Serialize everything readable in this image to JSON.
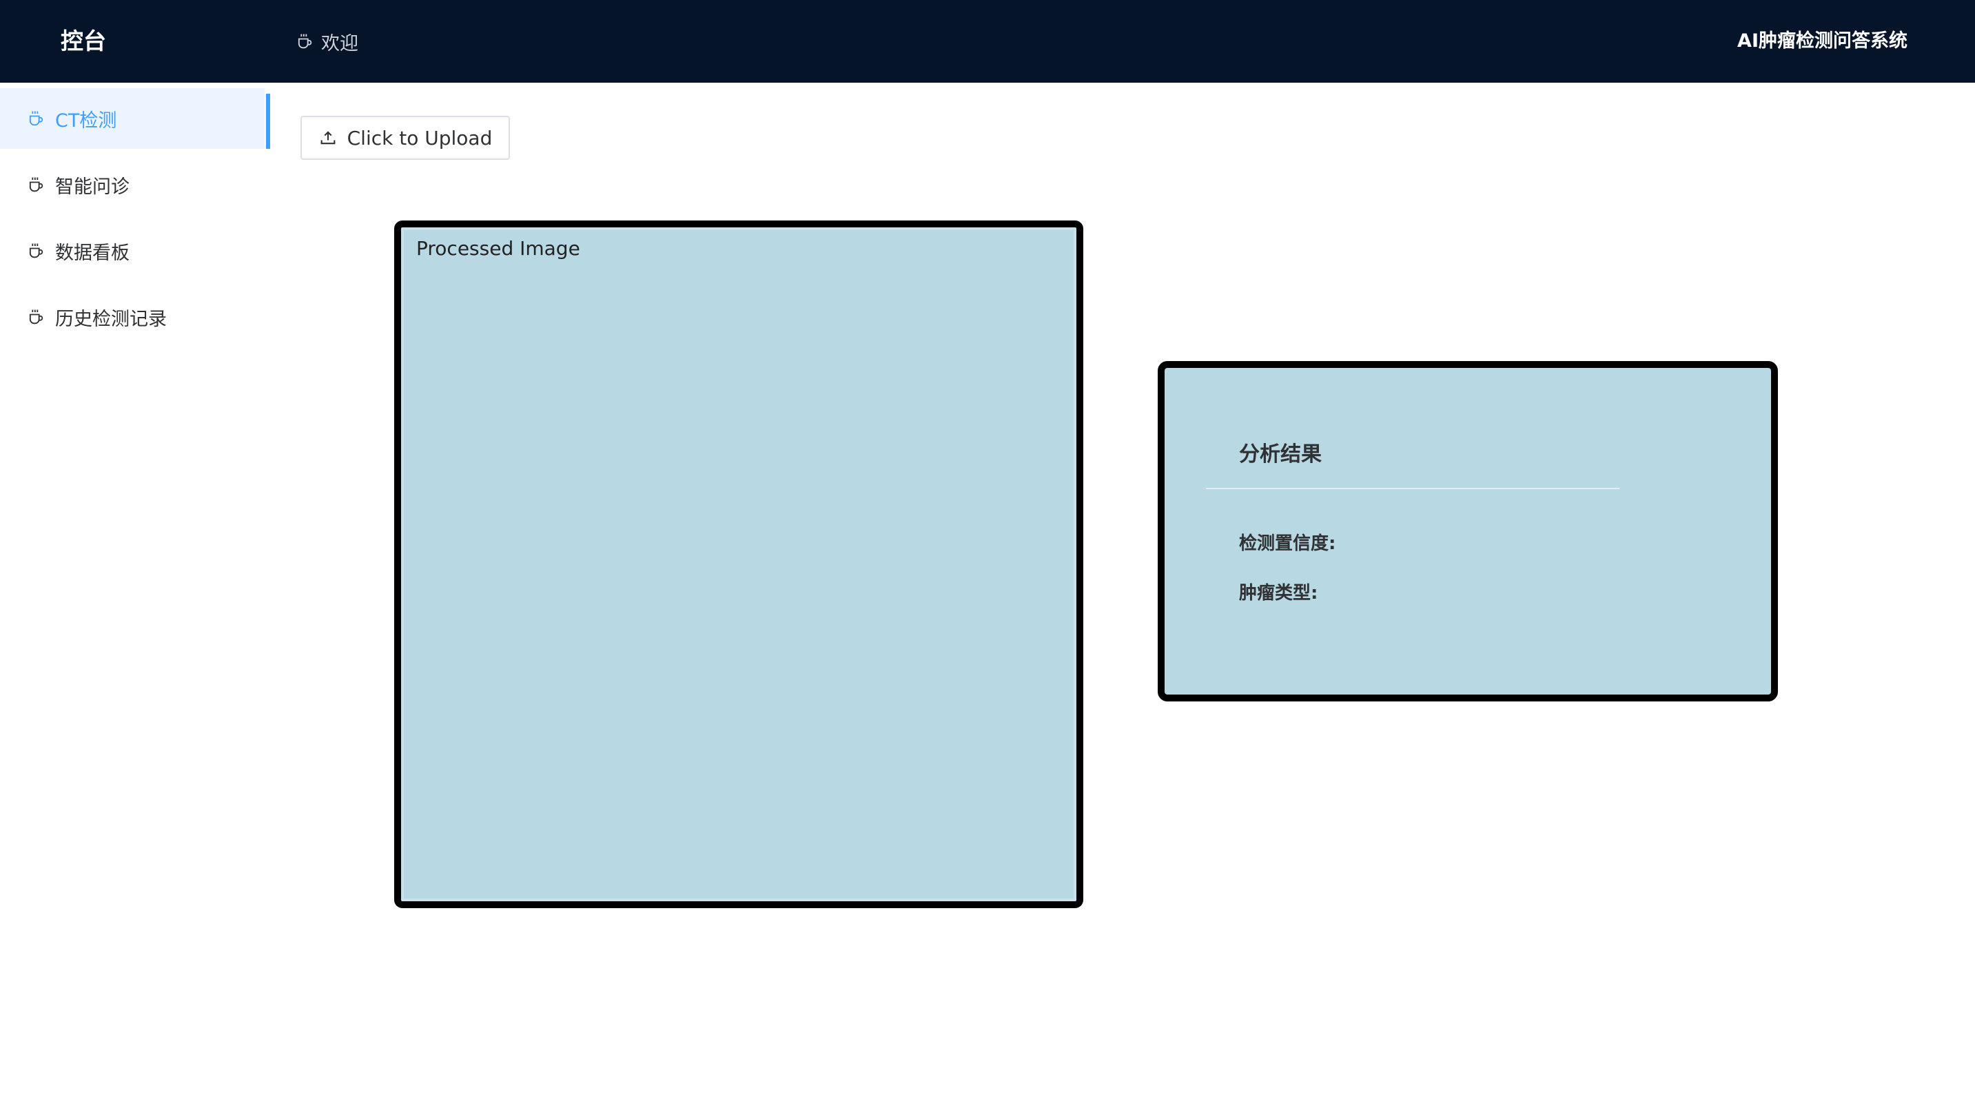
{
  "header": {
    "brand": "控台",
    "welcome": "欢迎",
    "system_title": "AI肿瘤检测问答系统"
  },
  "sidebar": {
    "items": [
      {
        "label": "CT检测",
        "icon": "coffee-cup-icon",
        "active": true
      },
      {
        "label": "智能问诊",
        "icon": "coffee-cup-icon",
        "active": false
      },
      {
        "label": "数据看板",
        "icon": "coffee-cup-icon",
        "active": false
      },
      {
        "label": "历史检测记录",
        "icon": "coffee-cup-icon",
        "active": false
      }
    ]
  },
  "main": {
    "upload_label": "Click to Upload",
    "image_label": "Processed Image",
    "result": {
      "title": "分析结果",
      "confidence_label": "检测置信度:",
      "confidence_value": "",
      "type_label": "肿瘤类型:",
      "type_value": ""
    }
  },
  "colors": {
    "header_bg": "#051428",
    "accent": "#409eff",
    "panel_bg": "#b8d8e4"
  }
}
